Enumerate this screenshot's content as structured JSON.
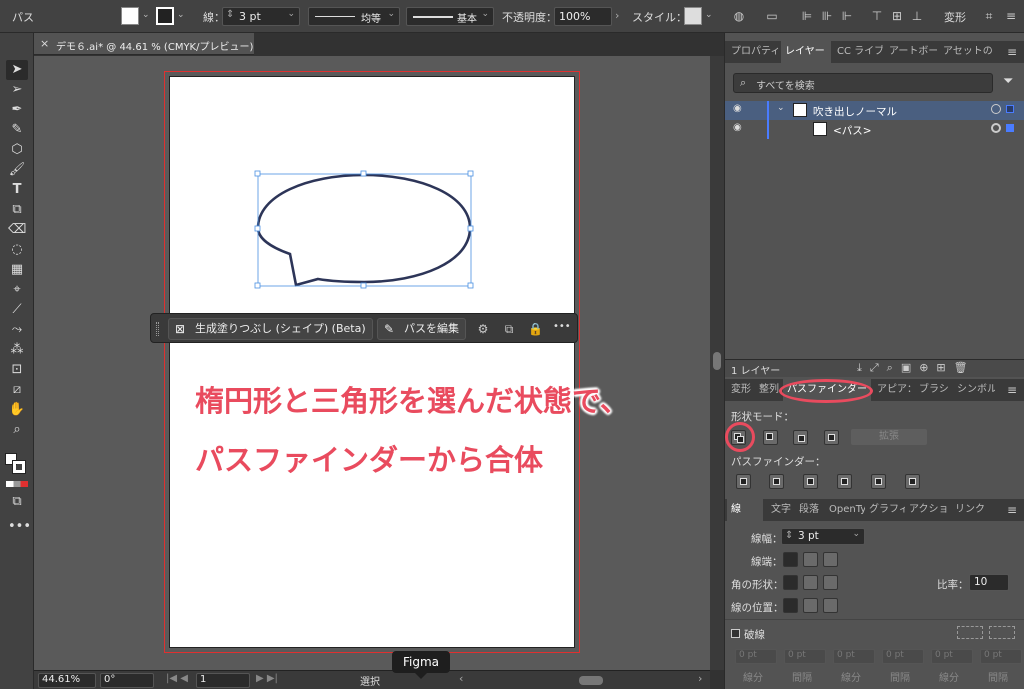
{
  "control_bar": {
    "selection": "パス",
    "stroke_label": "線：",
    "stroke_value": "3 pt",
    "profile1": "均等",
    "profile2": "基本",
    "opacity_label": "不透明度：",
    "opacity_value": "100%",
    "style_label": "スタイル：",
    "transform_label": "変形"
  },
  "document_tab": {
    "title": "デモ６.ai* @ 44.61 % (CMYK/プレビュー)",
    "close": "×"
  },
  "context_bar": {
    "generative_fill": "生成塗りつぶし (シェイプ) (Beta)",
    "edit_path": "パスを編集",
    "more": "•••"
  },
  "annotation": {
    "line1": "楕円形と三角形を選んだ状態で、",
    "line2": "パスファインダーから合体"
  },
  "status": {
    "zoom": "44.61%",
    "rotation": "0°",
    "artboard": "1",
    "mode": "選択"
  },
  "tooltip": "Figma",
  "layers_panel": {
    "tabs": [
      "プロパティ",
      "レイヤー",
      "CC ライブ",
      "アートボー",
      "アセットの"
    ],
    "search_placeholder": "すべてを検索",
    "layers": [
      {
        "name": "吹き出しノーマル"
      },
      {
        "name": "<パス>"
      }
    ],
    "count": "1 レイヤー"
  },
  "pathfinder_panel": {
    "tabs": [
      "変形",
      "整列",
      "パスファインダー",
      "アピア：",
      "ブラシ",
      "シンボル"
    ],
    "shape_modes_label": "形状モード：",
    "expand_label": "拡張",
    "pathfinders_label": "パスファインダー："
  },
  "stroke_panel": {
    "tabs": [
      "線",
      "文字",
      "段落",
      "OpenTy",
      "グラフィ",
      "アクショ",
      "リンク"
    ],
    "weight_label": "線幅：",
    "weight_value": "3 pt",
    "cap_label": "線端：",
    "corner_label": "角の形状：",
    "limit_label": "比率：",
    "limit_value": "10",
    "align_label": "線の位置：",
    "dashed_label": "破線",
    "dash_fields": [
      "線分",
      "間隔",
      "線分",
      "間隔",
      "線分",
      "間隔"
    ],
    "dash_value": "0 pt"
  },
  "colors": {
    "accent": "#e94b5e",
    "panel": "#535353",
    "selection": "#4a90e2"
  }
}
